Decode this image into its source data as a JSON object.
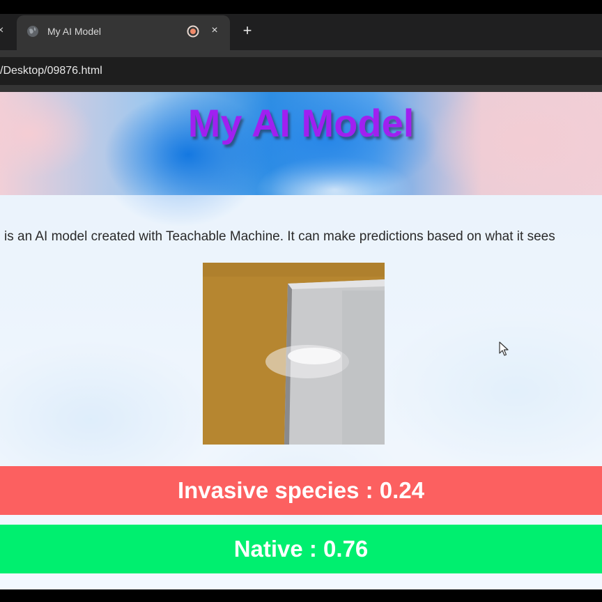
{
  "browser": {
    "tab_title": "My AI Model",
    "prev_tab_close": "×",
    "tab_close": "×",
    "new_tab": "+",
    "url": "/Desktop/09876.html"
  },
  "page": {
    "title": "My AI Model",
    "description": " is an AI model created with Teachable Machine. It can make predictions based on what it sees",
    "predictions": [
      {
        "label": "Invasive species : 0.24",
        "class": "Invasive species",
        "value": 0.24,
        "color": "#fc6060"
      },
      {
        "label": "Native : 0.76",
        "class": "Native",
        "value": 0.76,
        "color": "#00ef6f"
      }
    ]
  },
  "colors": {
    "title": "#a020f0",
    "tabbar": "#1f1f20",
    "toolbar": "#353535"
  },
  "icons": {
    "favicon": "globe-icon",
    "record": "recording-icon",
    "cursor": "mouse-pointer-icon"
  }
}
